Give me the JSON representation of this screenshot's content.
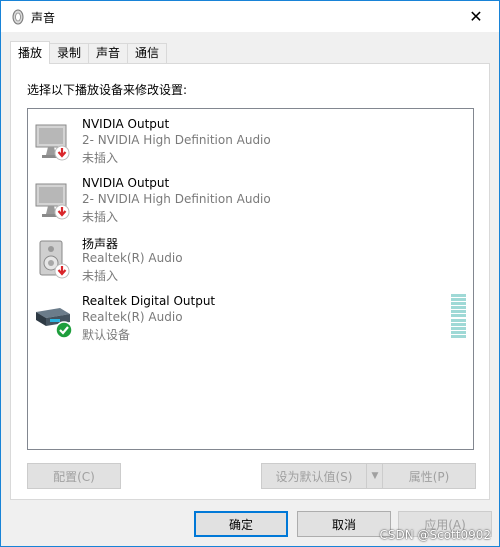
{
  "window": {
    "title": "声音"
  },
  "tabs": [
    {
      "label": "播放",
      "active": true
    },
    {
      "label": "录制",
      "active": false
    },
    {
      "label": "声音",
      "active": false
    },
    {
      "label": "通信",
      "active": false
    }
  ],
  "panel": {
    "instruction": "选择以下播放设备来修改设置:"
  },
  "devices": [
    {
      "name": "NVIDIA Output",
      "description": "2- NVIDIA High Definition Audio",
      "status": "未插入",
      "icon": "monitor-icon",
      "badge": "unplugged-arrow-icon"
    },
    {
      "name": "NVIDIA Output",
      "description": "2- NVIDIA High Definition Audio",
      "status": "未插入",
      "icon": "monitor-icon",
      "badge": "unplugged-arrow-icon"
    },
    {
      "name": "扬声器",
      "description": "Realtek(R) Audio",
      "status": "未插入",
      "icon": "speaker-icon",
      "badge": "unplugged-arrow-icon"
    },
    {
      "name": "Realtek Digital Output",
      "description": "Realtek(R) Audio",
      "status": "默认设备",
      "icon": "digital-output-icon",
      "badge": "default-check-icon"
    }
  ],
  "buttons": {
    "configure": "配置(C)",
    "set_default": "设为默认值(S)",
    "properties": "属性(P)",
    "ok": "确定",
    "cancel": "取消",
    "apply": "应用(A)"
  },
  "watermark": "CSDN @Scott0902",
  "colors": {
    "accent": "#0078d7",
    "unplugged": "#d9262b",
    "default_check": "#1e9e3c"
  }
}
